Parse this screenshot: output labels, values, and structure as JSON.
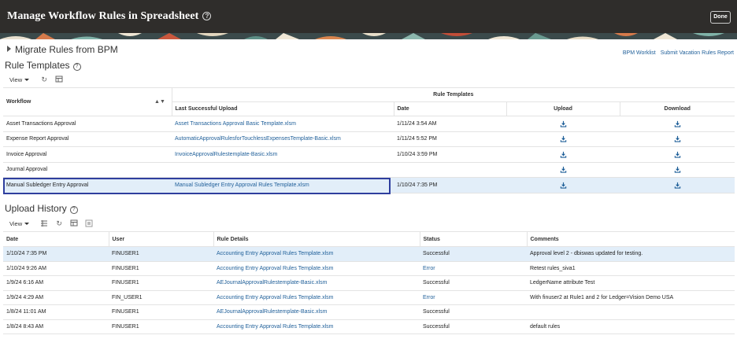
{
  "header": {
    "title": "Manage Workflow Rules in Spreadsheet",
    "help": "?",
    "done_label": "Done"
  },
  "migrate": {
    "label": "Migrate Rules from BPM"
  },
  "top_links": {
    "bpm_worklist": "BPM Worklist",
    "vacation": "Submit Vacation Rules Report"
  },
  "rule_templates": {
    "title": "Rule Templates",
    "help": "?",
    "view_label": "View",
    "group_header": "Rule Templates",
    "columns": {
      "workflow": "Workflow",
      "last_upload": "Last Successful Upload",
      "date": "Date",
      "upload": "Upload",
      "download": "Download"
    },
    "rows": [
      {
        "workflow": "Asset Transactions Approval",
        "last_upload": "Asset Transactions Approval Basic Template.xlsm",
        "date": "1/11/24 3:54 AM"
      },
      {
        "workflow": "Expense Report Approval",
        "last_upload": "AutomaticApprovalRulesforTouchlessExpensesTemplate-Basic.xlsm",
        "date": "1/11/24 5:52 PM"
      },
      {
        "workflow": "Invoice Approval",
        "last_upload": "InvoiceApprovalRulestemplate-Basic.xlsm",
        "date": "1/10/24 3:59 PM"
      },
      {
        "workflow": "Journal Approval",
        "last_upload": "",
        "date": ""
      },
      {
        "workflow": "Manual Subledger Entry Approval",
        "last_upload": "Manual Subledger Entry Approval Rules Template.xlsm",
        "date": "1/10/24 7:35 PM"
      }
    ]
  },
  "upload_history": {
    "title": "Upload History",
    "help": "?",
    "view_label": "View",
    "columns": {
      "date": "Date",
      "user": "User",
      "rule_details": "Rule Details",
      "status": "Status",
      "comments": "Comments"
    },
    "rows": [
      {
        "date": "1/10/24 7:35 PM",
        "user": "FINUSER1",
        "rule_details": "Accounting Entry Approval Rules Template.xlsm",
        "status": "Successful",
        "comments": "Approval level 2 - dbiswas updated for testing."
      },
      {
        "date": "1/10/24 9:26 AM",
        "user": "FINUSER1",
        "rule_details": "Accounting Entry Approval Rules Template.xlsm",
        "status": "Error",
        "comments": "Retest rules_siva1"
      },
      {
        "date": "1/9/24 6:16 AM",
        "user": "FINUSER1",
        "rule_details": "AEJournalApprovalRulestemplate-Basic.xlsm",
        "status": "Successful",
        "comments": "LedgerName attribute Test"
      },
      {
        "date": "1/9/24 4:29 AM",
        "user": "FIN_USER1",
        "rule_details": "Accounting Entry Approval Rules Template.xlsm",
        "status": "Error",
        "comments": "With finuser2 at Rule1 and 2 for Ledger=Vision Demo USA"
      },
      {
        "date": "1/8/24 11:01 AM",
        "user": "FINUSER1",
        "rule_details": "AEJournalApprovalRulestemplate-Basic.xlsm",
        "status": "Successful",
        "comments": ""
      },
      {
        "date": "1/8/24 8:43 AM",
        "user": "FINUSER1",
        "rule_details": "Accounting Entry Approval Rules Template.xlsm",
        "status": "Successful",
        "comments": "default rules"
      }
    ]
  },
  "colors": {
    "header_bg": "#2f2d2b",
    "link": "#1f5f99",
    "selected_row": "#e2eef9",
    "selection_border": "#2e3e9e"
  }
}
